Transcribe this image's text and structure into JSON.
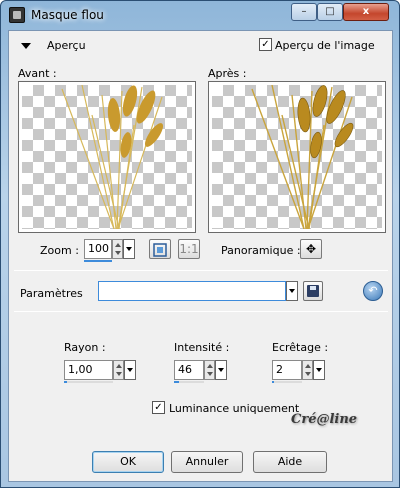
{
  "window": {
    "title": "Masque flou",
    "controls": {
      "minimize": "–",
      "maximize": "□",
      "close": "x"
    }
  },
  "preview": {
    "section_label": "Aperçu",
    "image_preview_checkbox": {
      "label": "Aperçu de l'image",
      "checked": true
    },
    "before_label": "Avant :",
    "after_label": "Après :",
    "zoom_label": "Zoom :",
    "zoom_value": "100",
    "pan_label": "Panoramique :",
    "fit_label": "1:1"
  },
  "parameters": {
    "label": "Paramètres",
    "preset_value": ""
  },
  "fields": {
    "radius": {
      "label": "Rayon :",
      "value": "1,00"
    },
    "intensity": {
      "label": "Intensité :",
      "value": "46"
    },
    "clipping": {
      "label": "Ecrêtage :",
      "value": "2"
    }
  },
  "luminance_checkbox": {
    "label": "Luminance uniquement",
    "checked": true
  },
  "watermark": "Cré@line",
  "buttons": {
    "ok": "OK",
    "cancel": "Annuler",
    "help": "Aide"
  },
  "colors": {
    "accent": "#3d8bdb",
    "title_bar": "#a9c6e2",
    "close": "#c4462d"
  }
}
